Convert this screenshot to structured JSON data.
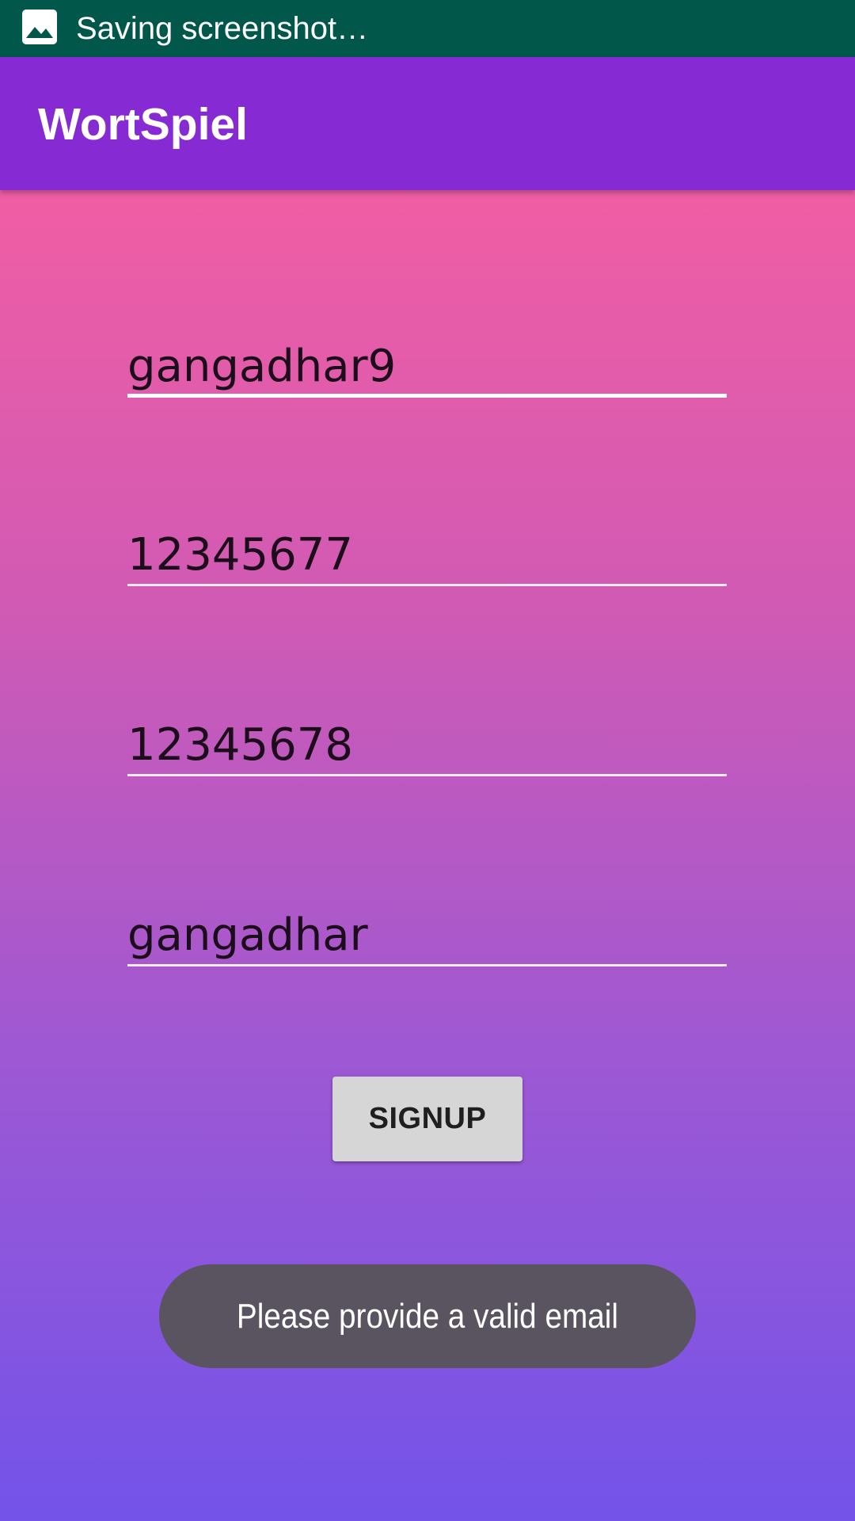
{
  "status_bar": {
    "icon": "image-icon",
    "text": "Saving screenshot…"
  },
  "app_bar": {
    "title": "WortSpiel"
  },
  "form": {
    "fields": [
      {
        "value": "gangadhar9",
        "focused": true
      },
      {
        "value": "12345677",
        "focused": false
      },
      {
        "value": "12345678",
        "focused": false
      },
      {
        "value": "gangadhar",
        "focused": false
      }
    ],
    "signup_label": "SIGNUP"
  },
  "toast": {
    "message": "Please provide a valid email"
  },
  "colors": {
    "status_bar": "#01574a",
    "app_bar": "#862ad3",
    "gradient_top": "#ff5f9c",
    "gradient_bottom": "#7353e9",
    "button": "#d6d6d6",
    "toast": "#5a5460"
  }
}
